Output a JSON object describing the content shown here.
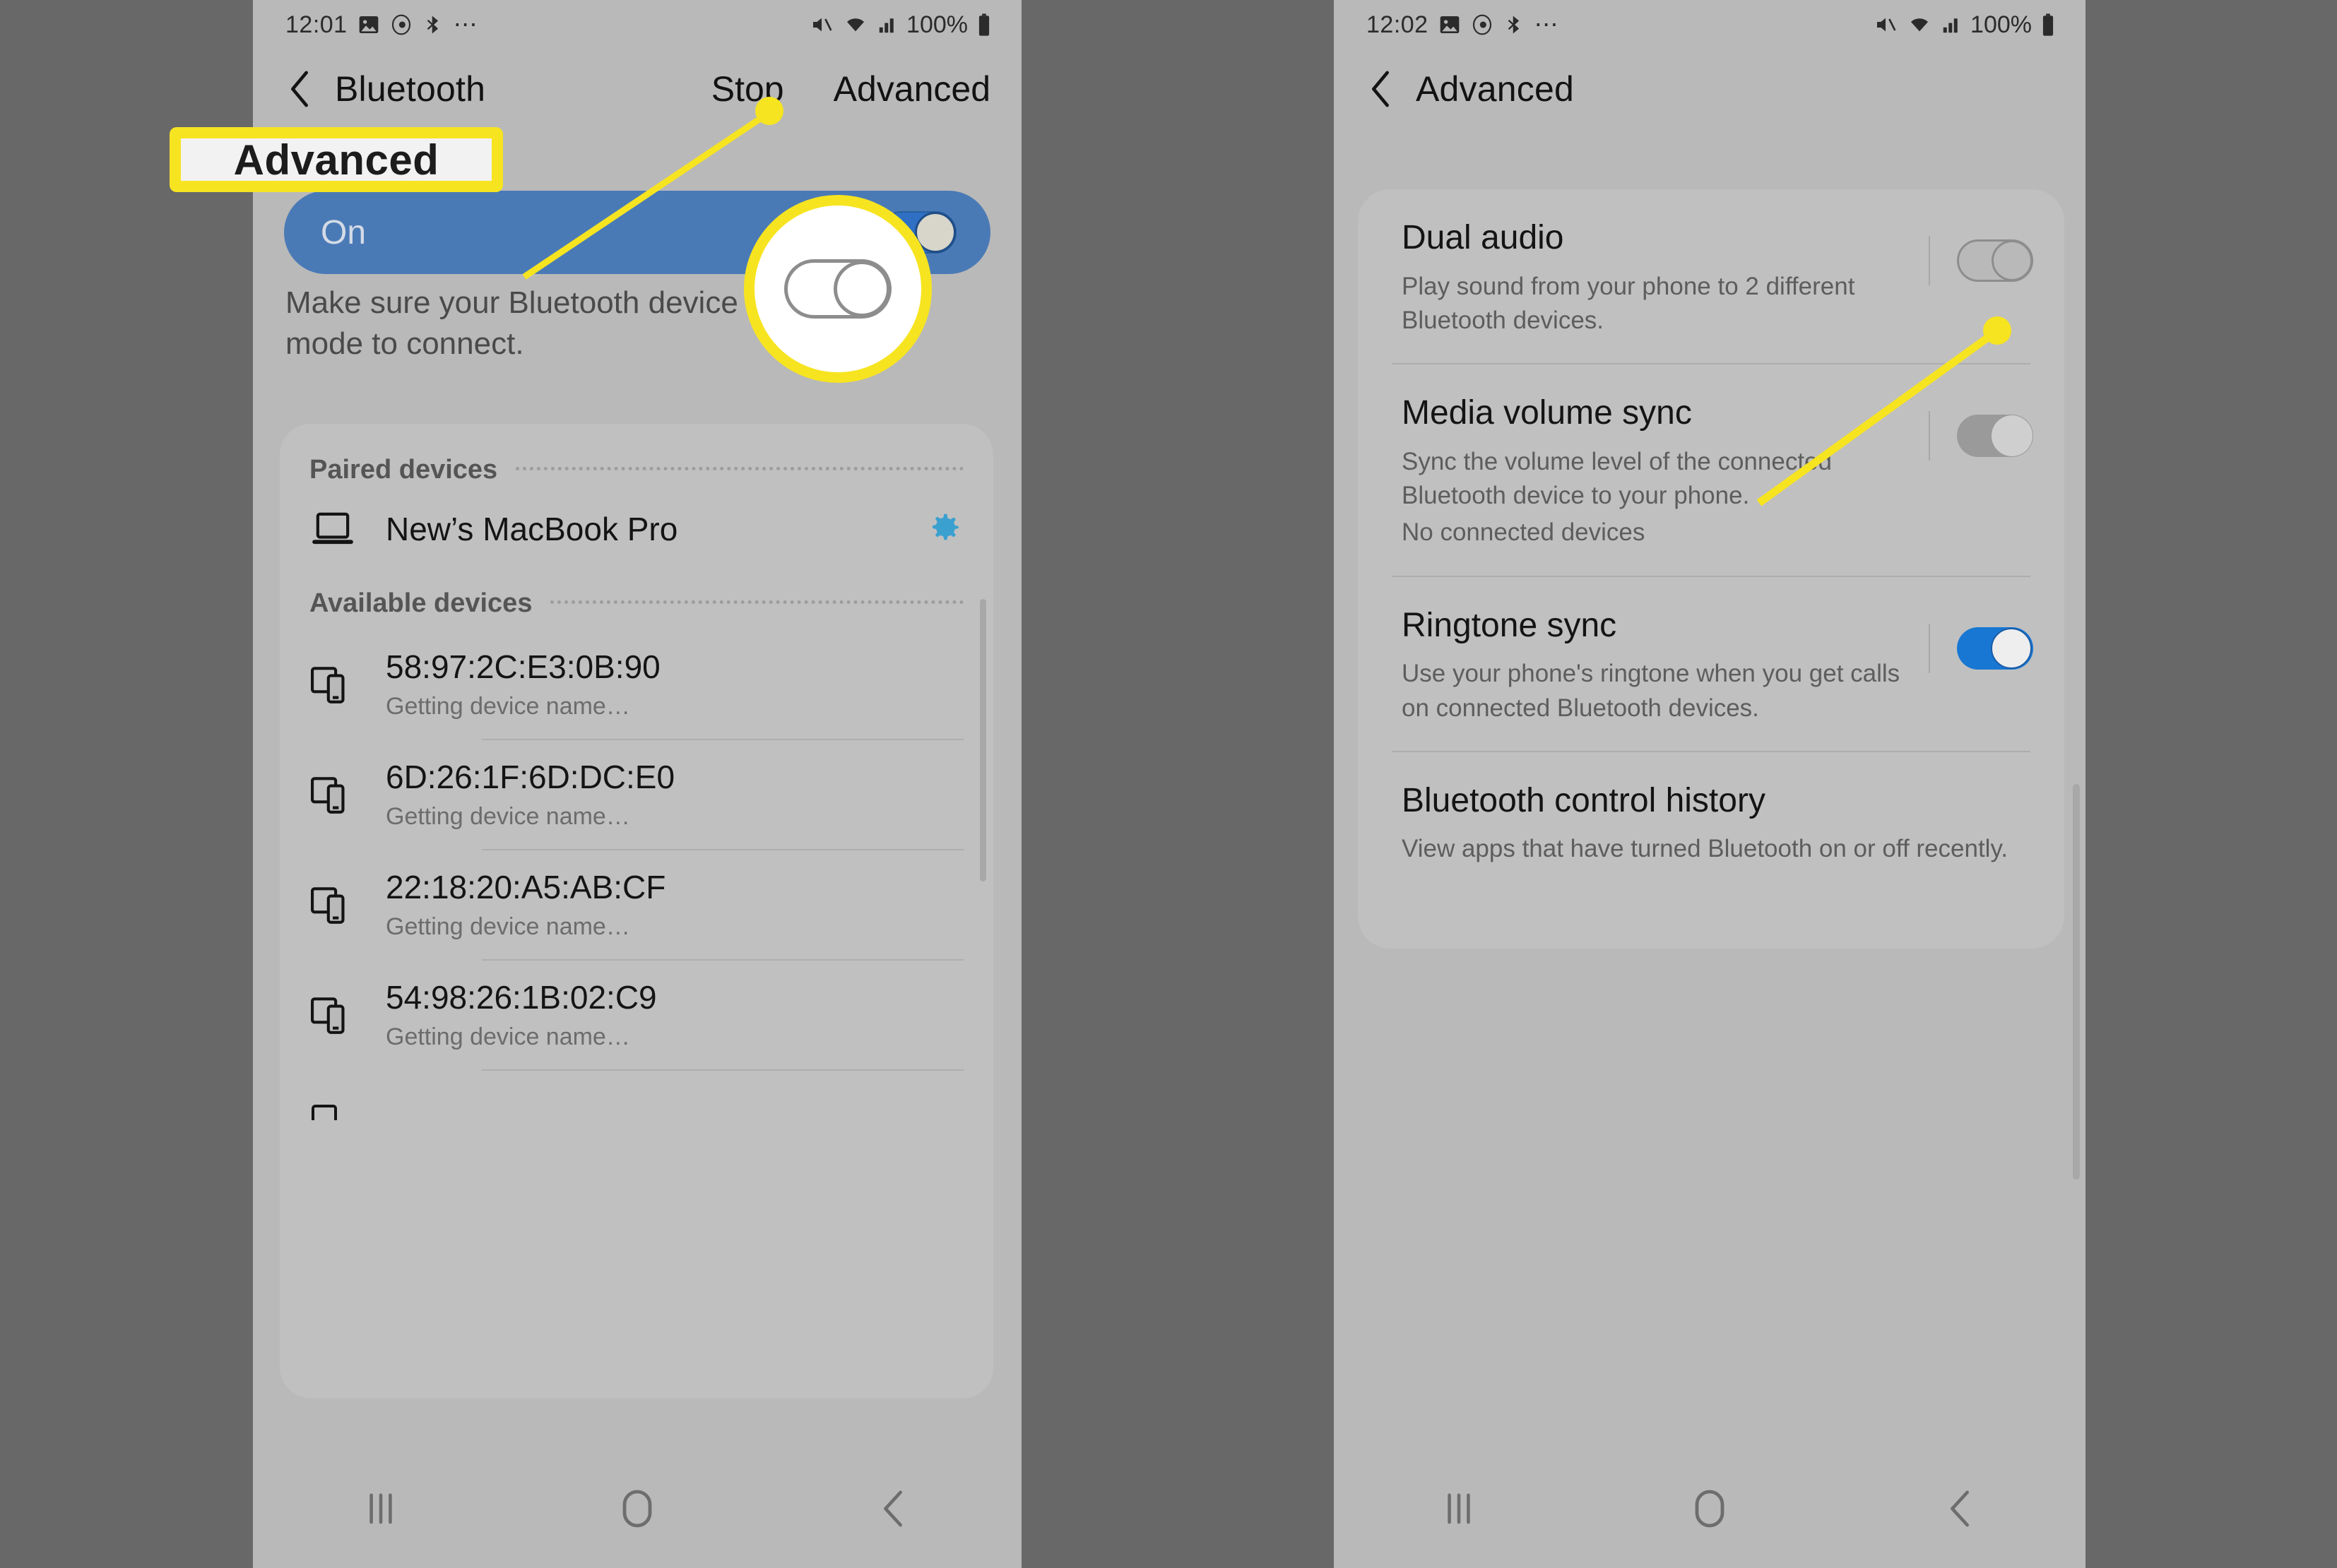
{
  "page": {
    "background_color": "#686868",
    "screen_color": "#b9b9b9",
    "accent_blue": "#4a7ab6",
    "toggle_on_blue": "#1877d2",
    "annotation_yellow": "#f7e420",
    "gear_blue": "#3aa0cf"
  },
  "left_phone": {
    "status_bar": {
      "time": "12:01",
      "battery_percent": "100%",
      "icons": [
        "image-icon",
        "eye-icon",
        "bluetooth-audio-icon",
        "more-dots-icon",
        "mute-icon",
        "wifi-icon",
        "signal-icon",
        "battery-icon"
      ]
    },
    "header": {
      "back_label": "back-chevron",
      "title": "Bluetooth",
      "action_stop": "Stop",
      "action_advanced": "Advanced"
    },
    "bluetooth_toggle_card": {
      "state_label": "On",
      "toggle_state": "on",
      "scanning": true
    },
    "hint_text": "Make sure your Bluetooth device is in pairing mode to connect.",
    "paired_section": {
      "title": "Paired devices",
      "devices": [
        {
          "name": "New’s MacBook Pro",
          "icon": "laptop-icon",
          "settings_icon": "gear-icon"
        }
      ]
    },
    "available_section": {
      "title": "Available devices",
      "devices": [
        {
          "name": "58:97:2C:E3:0B:90",
          "status": "Getting device name…",
          "icon": "devices-icon"
        },
        {
          "name": "6D:26:1F:6D:DC:E0",
          "status": "Getting device name…",
          "icon": "devices-icon"
        },
        {
          "name": "22:18:20:A5:AB:CF",
          "status": "Getting device name…",
          "icon": "devices-icon"
        },
        {
          "name": "54:98:26:1B:02:C9",
          "status": "Getting device name…",
          "icon": "devices-icon"
        }
      ]
    },
    "nav_bar": {
      "recents": "recents-icon",
      "home": "home-icon",
      "back": "back-icon"
    }
  },
  "right_phone": {
    "status_bar": {
      "time": "12:02",
      "battery_percent": "100%",
      "icons": [
        "image-icon",
        "eye-icon",
        "bluetooth-audio-icon",
        "more-dots-icon",
        "mute-icon",
        "wifi-icon",
        "signal-icon",
        "battery-icon"
      ]
    },
    "header": {
      "back_label": "back-chevron",
      "title": "Advanced"
    },
    "settings": [
      {
        "title": "Dual audio",
        "description": "Play sound from your phone to 2 different Bluetooth devices.",
        "toggle_state": "off",
        "toggle_style": "off-pale"
      },
      {
        "title": "Media volume sync",
        "description": "Sync the volume level of the connected Bluetooth device to your phone.",
        "extra": "No connected devices",
        "toggle_state": "off",
        "toggle_style": "off-solid"
      },
      {
        "title": "Ringtone sync",
        "description": "Use your phone's ringtone when you get calls on connected Bluetooth devices.",
        "toggle_state": "on",
        "toggle_style": "on-solid"
      },
      {
        "title": "Bluetooth control history",
        "description": "View apps that have turned Bluetooth on or off recently.",
        "toggle_state": "none",
        "toggle_style": "none"
      }
    ],
    "nav_bar": {
      "recents": "recents-icon",
      "home": "home-icon",
      "back": "back-icon"
    }
  },
  "annotations": {
    "callout_label": "Advanced",
    "callout_target": "advanced-header-action",
    "magnifier_target": "media-volume-sync-toggle",
    "dot_marker_left": "pointer-dot",
    "dot_marker_right": "pointer-dot"
  }
}
